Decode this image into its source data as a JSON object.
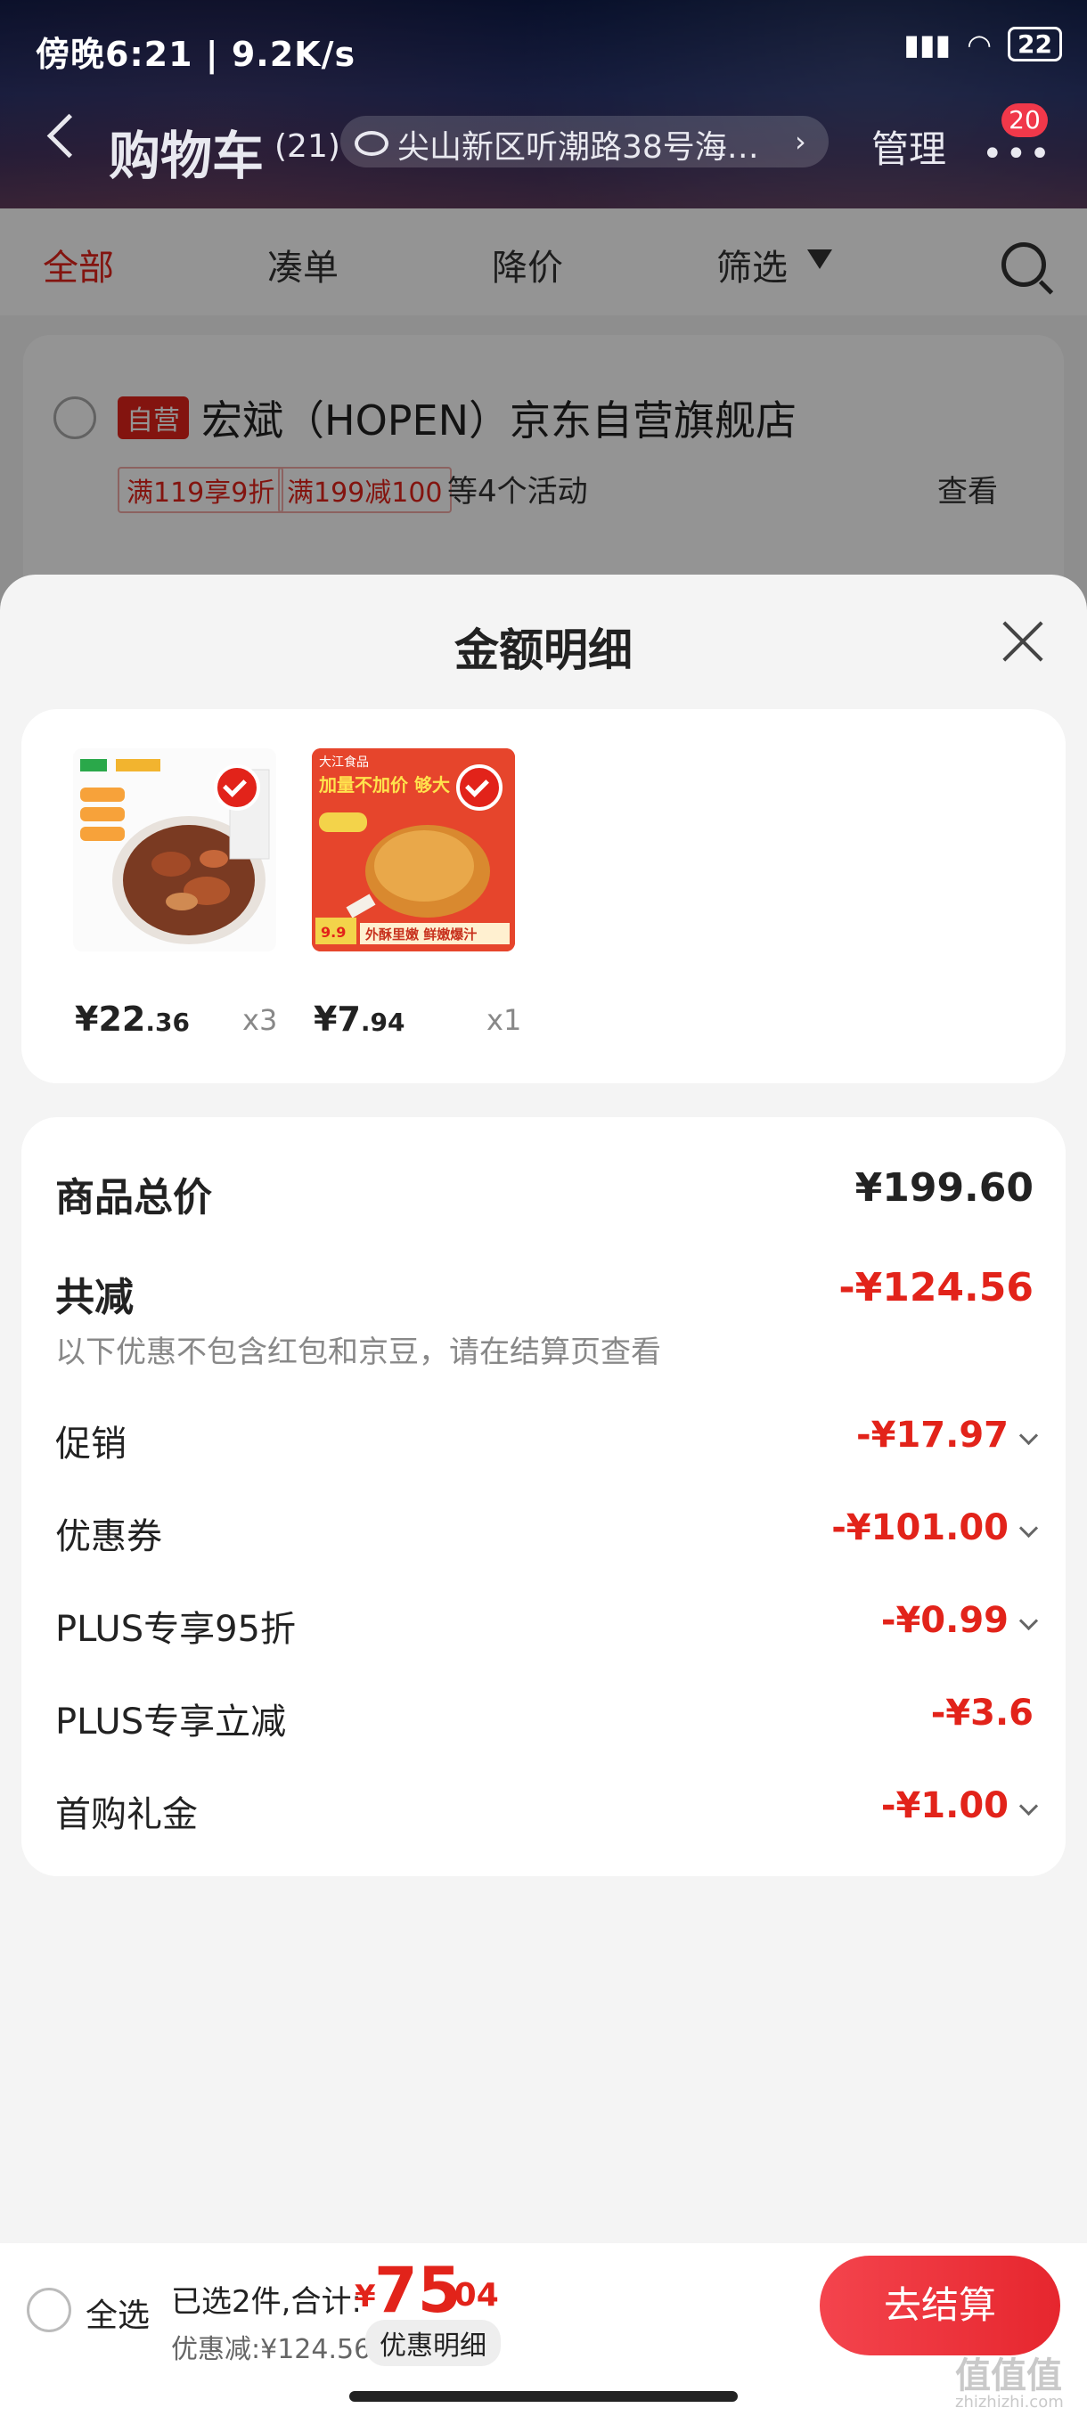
{
  "status_bar": {
    "time": "傍晚6:21 | 9.2K/s",
    "battery": "22"
  },
  "header": {
    "title": "购物车",
    "count": "(21)",
    "address": "尖山新区听潮路38号海…",
    "manage_label": "管理",
    "more_badge": "20"
  },
  "tabs": [
    "全部",
    "凑单",
    "降价",
    "筛选"
  ],
  "store": {
    "self_tag": "自营",
    "name": "宏斌（HOPEN）京东自营旗舰店",
    "promos": [
      "满119享9折",
      "满199减100"
    ],
    "promo_more": "等4个活动",
    "view_label": "查看"
  },
  "sheet": {
    "title": "金额明细",
    "items": [
      {
        "price_int": "¥22",
        "price_dec": ".36",
        "qty": "x3",
        "thumb_icon": "pepper-chicken-product-image"
      },
      {
        "price_int": "¥7",
        "price_dec": ".94",
        "qty": "x1",
        "thumb_icon": "roast-chicken-leg-product-image",
        "thumb_brand": "大江食品",
        "thumb_slogan": "加量不加价 够大",
        "thumb_price": "9.9",
        "thumb_tagline": "外酥里嫩 鲜嫩爆汁"
      }
    ],
    "total_label": "商品总价",
    "total_value": "¥199.60",
    "reduce_label": "共减",
    "reduce_value": "-¥124.56",
    "note": "以下优惠不包含红包和京豆，请在结算页查看",
    "rows": [
      {
        "label": "促销",
        "value": "-¥17.97",
        "chevron": true
      },
      {
        "label": "优惠券",
        "value": "-¥101.00",
        "chevron": true
      },
      {
        "label": "PLUS专享95折",
        "value": "-¥0.99",
        "chevron": true
      },
      {
        "label": "PLUS专享立减",
        "value": "-¥3.6",
        "chevron": false
      },
      {
        "label": "首购礼金",
        "value": "-¥1.00",
        "chevron": true
      }
    ]
  },
  "bottom": {
    "select_all": "全选",
    "selected_text": "已选2件,合计:",
    "currency": "¥",
    "total_int": "75",
    "total_dec": ".04",
    "discount_text": "优惠减:¥124.56",
    "detail_label": "优惠明细",
    "checkout_label": "去结算"
  },
  "watermark": {
    "main": "值值值",
    "sub": "zhizhizhi.com"
  },
  "colors": {
    "accent": "#e2231a"
  }
}
